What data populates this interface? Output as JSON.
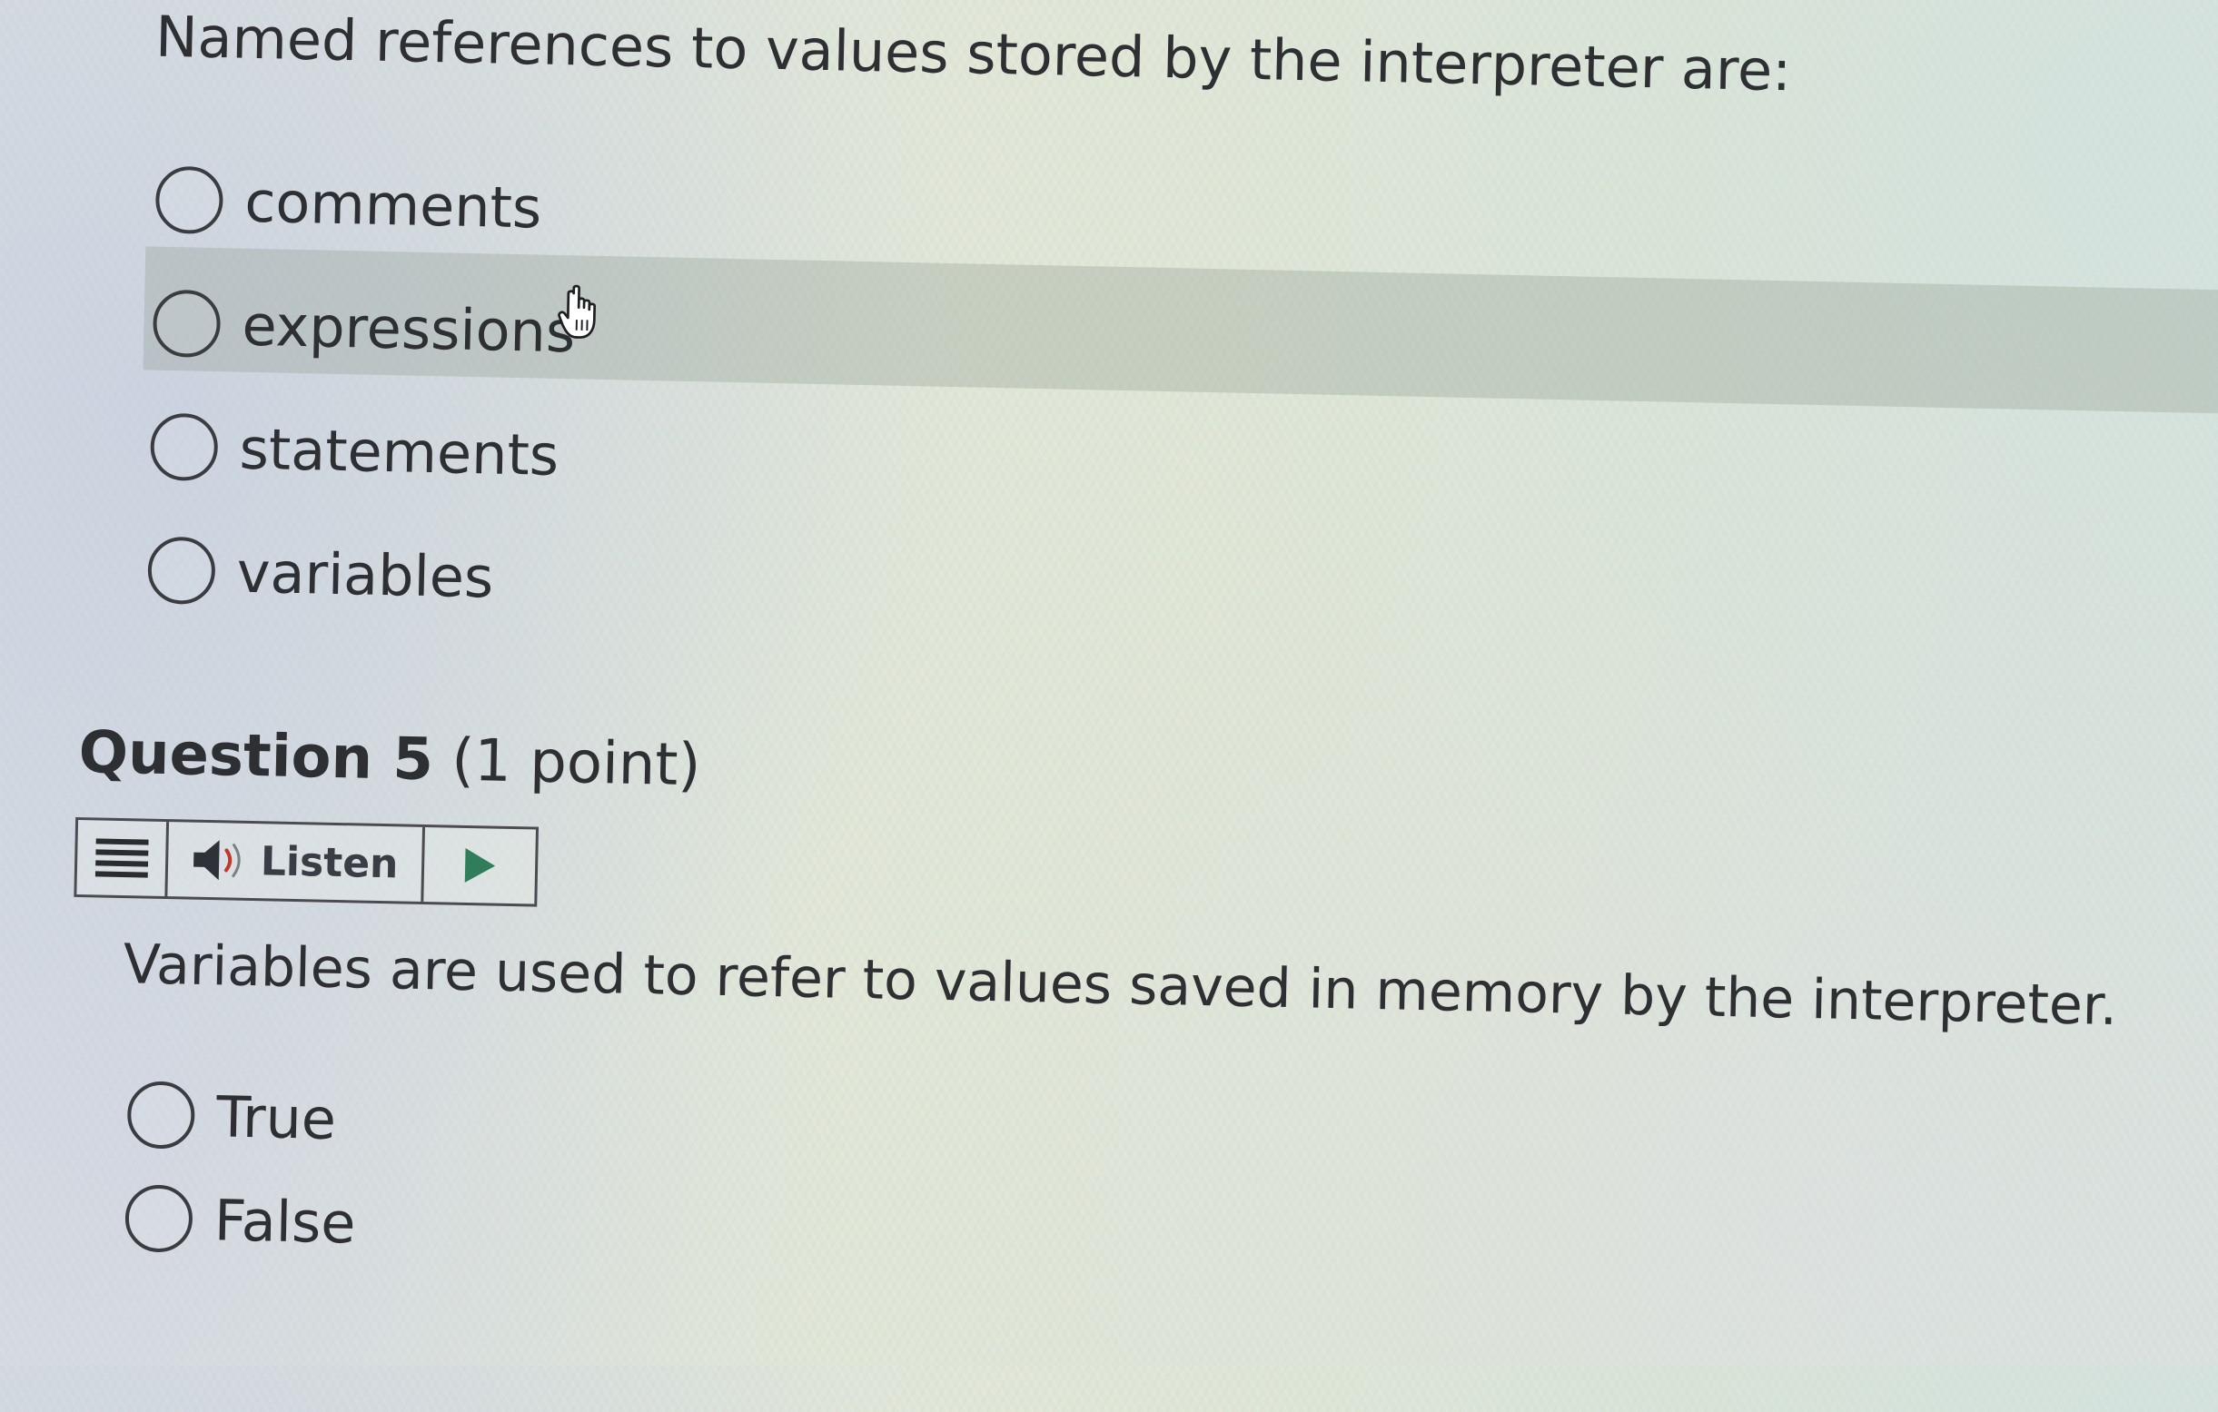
{
  "question4": {
    "prompt": "Named references to values stored by the interpreter are:",
    "options": [
      {
        "label": "comments"
      },
      {
        "label": "expressions"
      },
      {
        "label": "statements"
      },
      {
        "label": "variables"
      }
    ],
    "hovered_option": "expressions"
  },
  "question5": {
    "title": "Question 5",
    "points": "(1 point)",
    "listen_toolbar": {
      "menu_icon": "hamburger-menu-icon",
      "speaker_icon": "speaker-icon",
      "listen_label": "Listen",
      "play_icon": "play-icon"
    },
    "statement": "Variables are used to refer to values saved in memory by the interpreter.",
    "options": [
      {
        "label": "True"
      },
      {
        "label": "False"
      }
    ]
  },
  "colors": {
    "text": "#2d2f33",
    "play_icon": "#2f7d5b",
    "hover_highlight": "#a0a8a0"
  },
  "cursor_icon": "hand-pointer-icon"
}
